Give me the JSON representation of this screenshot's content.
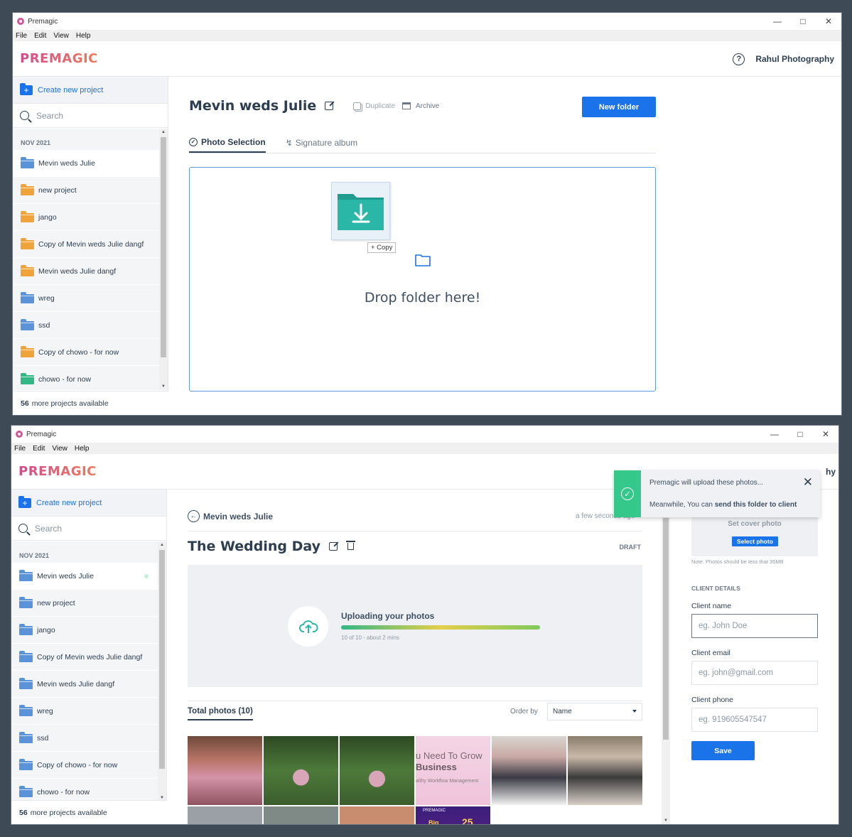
{
  "window1": {
    "title": "Premagic",
    "menu": [
      "File",
      "Edit",
      "View",
      "Help"
    ],
    "logo": "PREMAGIC",
    "account": "Rahul Photography",
    "sidebar": {
      "create_label": "Create new project",
      "search_placeholder": "Search",
      "group": "NOV 2021",
      "items": [
        {
          "label": "Mevin weds Julie",
          "color": "#5b93d9"
        },
        {
          "label": "new project",
          "color": "#f0a33a"
        },
        {
          "label": "jango",
          "color": "#f0a33a"
        },
        {
          "label": "Copy of Mevin weds Julie dangf",
          "color": "#f0a33a"
        },
        {
          "label": "Mevin weds Julie dangf",
          "color": "#f0a33a"
        },
        {
          "label": "wreg",
          "color": "#5b93d9"
        },
        {
          "label": "ssd",
          "color": "#5b93d9"
        },
        {
          "label": "Copy of chowo - for now",
          "color": "#f0a33a"
        },
        {
          "label": "chowo - for now",
          "color": "#34b787"
        }
      ],
      "more_count": "56",
      "more_label": "more projects available"
    },
    "main": {
      "title": "Mevin weds Julie",
      "duplicate": "Duplicate",
      "archive": "Archive",
      "new_folder": "New folder",
      "tabs": [
        "Photo Selection",
        "Signature album"
      ],
      "copy_badge": "+ Copy",
      "drop_text": "Drop folder here!"
    }
  },
  "window2": {
    "title": "Premagic",
    "menu": [
      "File",
      "Edit",
      "View",
      "Help"
    ],
    "logo": "PREMAGIC",
    "account_partial": "hy",
    "sidebar": {
      "create_label": "Create new project",
      "search_placeholder": "Search",
      "group": "NOV 2021",
      "items": [
        {
          "label": "Mevin weds Julie",
          "color": "#5b93d9"
        },
        {
          "label": "new project",
          "color": "#5b93d9"
        },
        {
          "label": "jango",
          "color": "#5b93d9"
        },
        {
          "label": "Copy of Mevin weds Julie dangf",
          "color": "#5b93d9"
        },
        {
          "label": "Mevin weds Julie dangf",
          "color": "#5b93d9"
        },
        {
          "label": "wreg",
          "color": "#5b93d9"
        },
        {
          "label": "ssd",
          "color": "#5b93d9"
        },
        {
          "label": "Copy of chowo - for now",
          "color": "#5b93d9"
        },
        {
          "label": "chowo - for now",
          "color": "#5b93d9"
        }
      ],
      "more_count": "56",
      "more_label": "more projects available"
    },
    "main": {
      "back_label": "Mevin weds Julie",
      "timestamp": "a few seconds ago",
      "title": "The Wedding Day",
      "status": "DRAFT",
      "upload_title": "Uploading your photos",
      "upload_progress": 1.0,
      "upload_sub": "10 of 10 - about 2 mins",
      "total_photos": "Total photos (10)",
      "order_by": "Order by",
      "order_value": "Name",
      "photo_texts": [
        "u Need To Grow",
        "Business",
        "althy Workflow Management",
        "PREMAGIC",
        "Big",
        "25"
      ]
    },
    "panel": {
      "cover_label": "Set cover photo",
      "select_photo": "Select photo",
      "note": "Note: Photos should be less that 35MB",
      "section": "CLIENT DETAILS",
      "name_label": "Client name",
      "name_placeholder": "eg. John Doe",
      "email_label": "Client email",
      "email_placeholder": "eg. john@gmail.com",
      "phone_label": "Client phone",
      "phone_placeholder": "eg. 919605547547",
      "save": "Save"
    },
    "toast": {
      "line1": "Premagic will upload these photos...",
      "line2_prefix": "Meanwhile, You can ",
      "line2_bold": "send this folder to client"
    }
  }
}
